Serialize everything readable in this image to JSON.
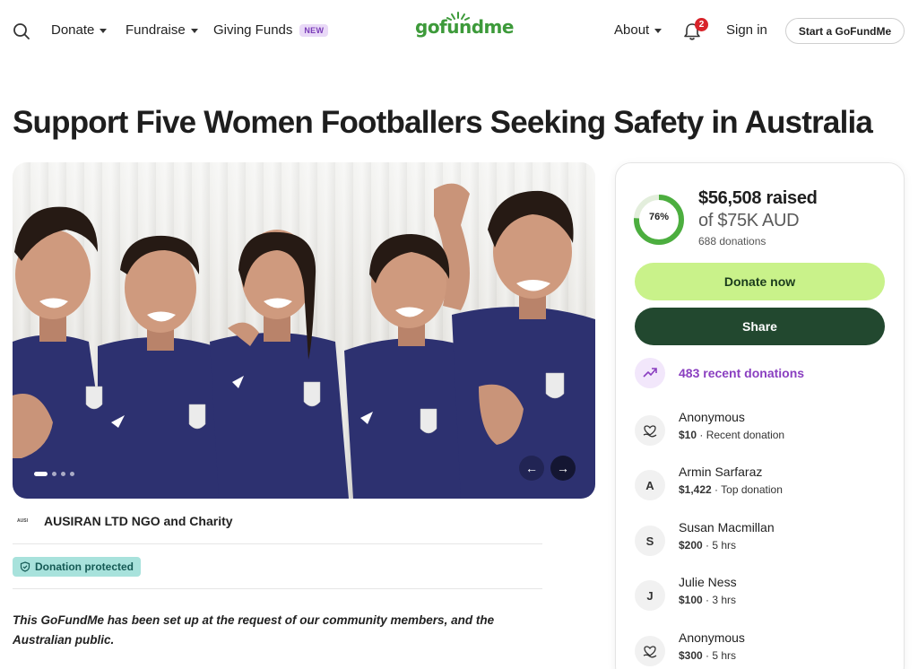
{
  "nav": {
    "donate": "Donate",
    "fundraise": "Fundraise",
    "giving_funds": "Giving Funds",
    "new_badge": "NEW",
    "logo": "gofundme",
    "about": "About",
    "notification_count": "2",
    "signin": "Sign in",
    "start": "Start a GoFundMe"
  },
  "campaign": {
    "title": "Support Five Women Footballers Seeking Safety in Australia",
    "organizer": "AUSIRAN LTD NGO and Charity",
    "organizer_logo_text": "AUSI",
    "protected": "Donation protected",
    "story": "This GoFundMe has been set up at the request of our community members, and the Australian public.",
    "carousel": {
      "slides": 4,
      "active": 1
    }
  },
  "progress": {
    "percent_label": "76%",
    "percent_value": 0.76,
    "raised": "$56,508 raised",
    "goal": "of $75K AUD",
    "donations": "688 donations"
  },
  "actions": {
    "donate": "Donate now",
    "share": "Share",
    "recent": "483 recent donations"
  },
  "donors": [
    {
      "name": "Anonymous",
      "avatar": "heart-hand-icon",
      "amount": "$10",
      "note": " · Recent donation"
    },
    {
      "name": "Armin Sarfaraz",
      "avatar": "A",
      "amount": "$1,422",
      "note": " · Top donation"
    },
    {
      "name": "Susan Macmillan",
      "avatar": "S",
      "amount": "$200",
      "note": " · 5 hrs"
    },
    {
      "name": "Julie Ness",
      "avatar": "J",
      "amount": "$100",
      "note": " · 3 hrs"
    },
    {
      "name": "Anonymous",
      "avatar": "heart-hand-icon",
      "amount": "$300",
      "note": " · 5 hrs"
    }
  ],
  "colors": {
    "brand_green": "#3d9a3a",
    "donate_button": "#c9f28a",
    "share_button": "#22482f",
    "recent_purple": "#8a3fc0",
    "protected_badge": "#a8e2dc"
  }
}
